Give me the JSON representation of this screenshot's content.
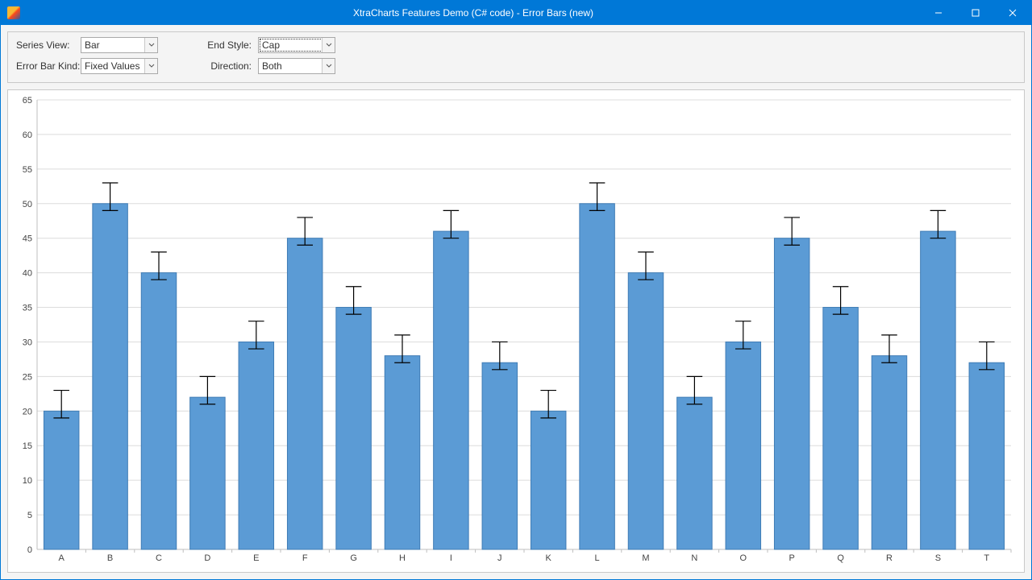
{
  "window": {
    "title": "XtraCharts Features Demo (C# code) - Error Bars (new)"
  },
  "toolbar": {
    "series_view_label": "Series View:",
    "series_view_value": "Bar",
    "error_bar_kind_label": "Error Bar Kind:",
    "error_bar_kind_value": "Fixed Values",
    "end_style_label": "End Style:",
    "end_style_value": "Cap",
    "direction_label": "Direction:",
    "direction_value": "Both"
  },
  "chart_data": {
    "type": "bar",
    "categories": [
      "A",
      "B",
      "C",
      "D",
      "E",
      "F",
      "G",
      "H",
      "I",
      "J",
      "K",
      "L",
      "M",
      "N",
      "O",
      "P",
      "Q",
      "R",
      "S",
      "T"
    ],
    "values": [
      20,
      50,
      40,
      22,
      30,
      45,
      35,
      28,
      46,
      27,
      20,
      50,
      40,
      22,
      30,
      45,
      35,
      28,
      46,
      27
    ],
    "error_positive": 3,
    "error_negative": 1,
    "xlabel": "",
    "ylabel": "",
    "ylim": [
      0,
      65
    ],
    "ystep": 5,
    "end_style": "Cap",
    "direction": "Both"
  }
}
